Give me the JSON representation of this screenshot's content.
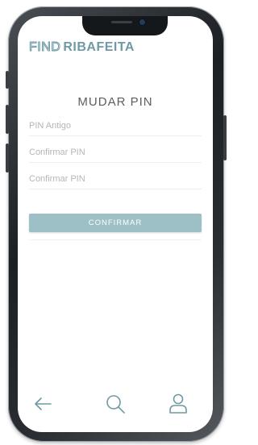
{
  "brand": {
    "logo_light": "FIND",
    "logo_bold": "RIBAFEITA",
    "accent": "#6f9aa4"
  },
  "page": {
    "title": "MUDAR PIN"
  },
  "form": {
    "old_pin_placeholder": "PIN Antigo",
    "new_pin_placeholder": "Confirmar PIN",
    "confirm_pin_placeholder": "Confirmar PIN",
    "old_pin_value": "",
    "new_pin_value": "",
    "confirm_pin_value": "",
    "submit_label": "CONFIRMAR",
    "button_color": "#9dbfc6"
  },
  "nav": {
    "items": [
      {
        "icon": "back-arrow-icon"
      },
      {
        "icon": "search-icon"
      },
      {
        "icon": "user-icon"
      }
    ]
  }
}
